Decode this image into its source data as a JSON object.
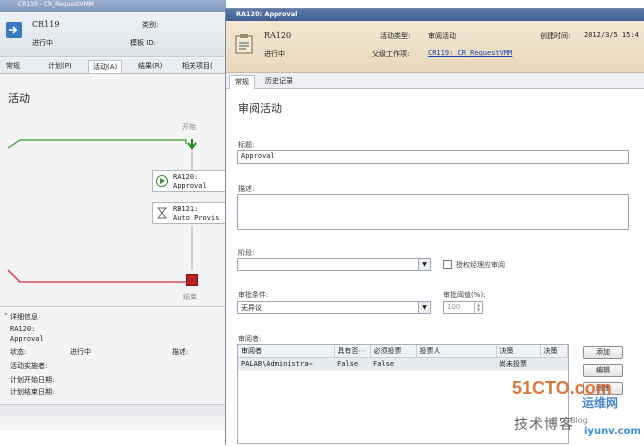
{
  "background_window": {
    "title": "CR119 - CR_RequestVMM",
    "name": "CR119",
    "status": "进行中",
    "category_label": "类别:",
    "template_label": "模板 ID:",
    "tabs": [
      {
        "label": "常规"
      },
      {
        "label": "计划(P)"
      },
      {
        "label": "活动(A)"
      },
      {
        "label": "结果(R)"
      },
      {
        "label": "相关项目("
      }
    ],
    "activity_heading": "活动",
    "flow": {
      "start_label": "开始",
      "end_label": "结束",
      "items": [
        {
          "id": "RA120:",
          "name": "Approval"
        },
        {
          "id": "RB121:",
          "name": "Auto Provis"
        }
      ]
    },
    "details": {
      "heading": "详细信息",
      "id": "RA120:",
      "name": "Approval",
      "status_label": "状态:",
      "status_value": "进行中",
      "desc_label": "描述:",
      "implementer_label": "活动实施者:",
      "plan_start_label": "计划开始日期:",
      "plan_end_label": "计划结束日期:"
    }
  },
  "dialog": {
    "title": "RA120: Approval",
    "name": "RA120",
    "status": "进行中",
    "activity_type_label": "活动类型:",
    "activity_type_value": "审阅活动",
    "parent_label": "父级工作项:",
    "parent_value": "CR119: CR_RequestVMM",
    "created_label": "创建时间:",
    "created_value": "2012/3/5 15:4",
    "tabs": [
      {
        "label": "常规"
      },
      {
        "label": "历史记录"
      }
    ],
    "section_title": "审阅活动",
    "title_label": "标题:",
    "title_value": "Approval",
    "desc_label": "描述:",
    "desc_value": "",
    "stage_label": "阶段:",
    "stage_value": "",
    "manager_checkbox_label": "授权经理应审阅",
    "approval_condition_label": "审批条件:",
    "approval_condition_value": "无异议",
    "threshold_label": "审批阈值(%):",
    "threshold_value": "100",
    "reviewers_label": "审阅者:",
    "reviewers_table": {
      "columns": [
        "审阅者",
        "具有否⋯",
        "必须投票",
        "投票人",
        "决策",
        "决策"
      ],
      "rows": [
        [
          "PALAB\\Administra⋯",
          "False",
          "False",
          "",
          "尚未投票",
          ""
        ]
      ]
    },
    "buttons": {
      "add": "添加",
      "edit": "编辑",
      "delete": "删除"
    }
  },
  "watermark": {
    "site": "51CTO.com",
    "subtitle": "技术博客",
    "overlay": "运维网",
    "url": "iyunv.com",
    "blog_tag": "Blog"
  }
}
